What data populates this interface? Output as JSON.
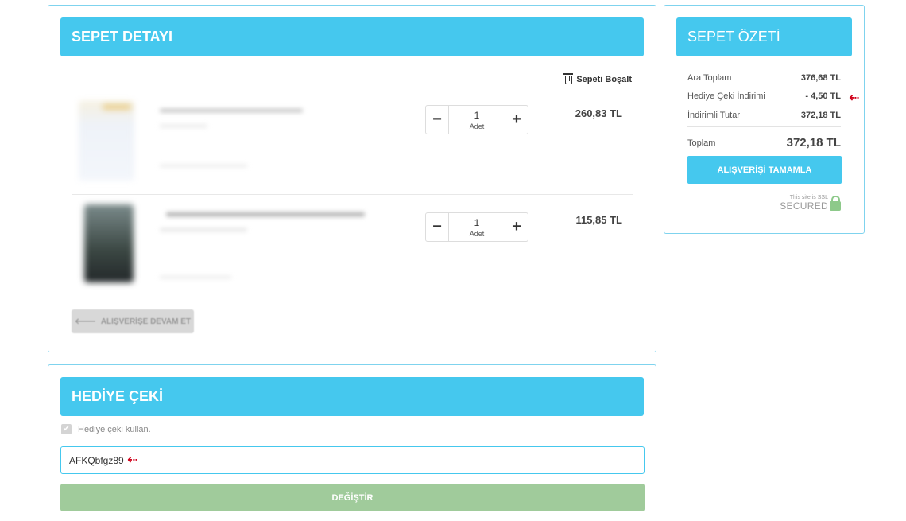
{
  "cart": {
    "title": "SEPET DETAYI",
    "empty_label": "Sepeti Boşalt",
    "items": [
      {
        "quantity": "1",
        "unit": "Adet",
        "price": "260,83 TL"
      },
      {
        "quantity": "1",
        "unit": "Adet",
        "price": "115,85 TL"
      }
    ],
    "continue_label": "ALIŞVERİŞE DEVAM ET"
  },
  "gift": {
    "title": "HEDİYE ÇEKİ",
    "checkbox_label": "Hediye çeki kullan.",
    "code_value": "AFKQbfgz89",
    "change_label": "DEĞİŞTİR"
  },
  "summary": {
    "title": "SEPET ÖZETİ",
    "subtotal_label": "Ara Toplam",
    "subtotal_value": "376,68 TL",
    "discount_label": "Hediye Çeki İndirimi",
    "discount_value": "- 4,50 TL",
    "discounted_label": "İndirimli Tutar",
    "discounted_value": "372,18 TL",
    "total_label": "Toplam",
    "total_value": "372,18 TL",
    "checkout_label": "ALIŞVERİŞİ TAMAMLA",
    "ssl_small": "This site is SSL",
    "ssl_big": "SECURED"
  },
  "annotations": {
    "arrow": "⇠",
    "color": "#d0011b"
  },
  "colors": {
    "accent": "#45c8ee",
    "border": "#7fd3ee",
    "change_button": "#a0cb9b",
    "lock": "#8dc98a"
  }
}
